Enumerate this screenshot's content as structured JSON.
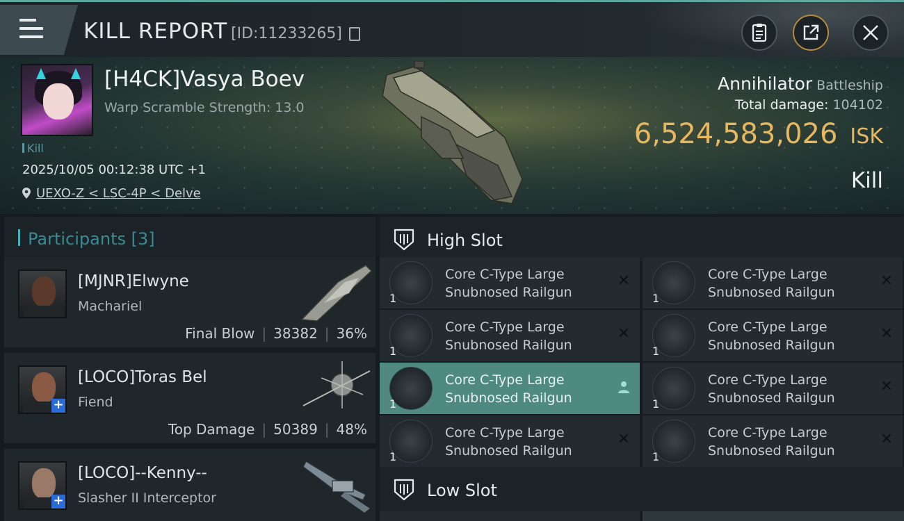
{
  "header": {
    "title": "KILL REPORT",
    "report_id": "[ID:11233265]"
  },
  "victim": {
    "name": "[H4CK]Vasya Boev",
    "warp_scramble": "Warp Scramble Strength: 13.0",
    "tag": "Kill",
    "timestamp": "2025/10/05 00:12:38 UTC +1",
    "location": "UEXO-Z < LSC-4P < Delve",
    "ship_name": "Annihilator",
    "ship_class": "Battleship",
    "total_damage_label": "Total damage:",
    "total_damage_value": "104102",
    "isk_value": "6,524,583,026",
    "isk_unit": "ISK",
    "result": "Kill"
  },
  "participants": {
    "label": "Participants",
    "count": "[3]",
    "rows": [
      {
        "name": "[MJNR]Elwyne",
        "ship": "Machariel",
        "role": "Final Blow",
        "damage": "38382",
        "percent": "36%"
      },
      {
        "name": "[LOCO]Toras Bel",
        "ship": "Fiend",
        "role": "Top Damage",
        "damage": "50389",
        "percent": "48%"
      },
      {
        "name": "[LOCO]--Kenny--",
        "ship": "Slasher II Interceptor",
        "role": "",
        "damage": "",
        "percent": ""
      }
    ]
  },
  "fitting": {
    "high_slot_label": "High Slot",
    "low_slot_label": "Low Slot",
    "high_slot_modules": [
      {
        "name_line1": "Core C-Type Large",
        "name_line2": "Snubnosed Railgun",
        "qty": "1",
        "status": "destroyed"
      },
      {
        "name_line1": "Core C-Type Large",
        "name_line2": "Snubnosed Railgun",
        "qty": "1",
        "status": "destroyed"
      },
      {
        "name_line1": "Core C-Type Large",
        "name_line2": "Snubnosed Railgun",
        "qty": "1",
        "status": "destroyed"
      },
      {
        "name_line1": "Core C-Type Large",
        "name_line2": "Snubnosed Railgun",
        "qty": "1",
        "status": "destroyed"
      },
      {
        "name_line1": "Core C-Type Large",
        "name_line2": "Snubnosed Railgun",
        "qty": "1",
        "status": "dropped"
      },
      {
        "name_line1": "Core C-Type Large",
        "name_line2": "Snubnosed Railgun",
        "qty": "1",
        "status": "destroyed"
      },
      {
        "name_line1": "Core C-Type Large",
        "name_line2": "Snubnosed Railgun",
        "qty": "1",
        "status": "destroyed"
      },
      {
        "name_line1": "Core C-Type Large",
        "name_line2": "Snubnosed Railgun",
        "qty": "1",
        "status": "destroyed"
      }
    ]
  },
  "colors": {
    "accent_teal": "#4bb0b8",
    "isk_gold": "#e8b860",
    "active_module": "#4f8a82",
    "share_ring": "#b58b3e"
  },
  "icons": {
    "menu": "hamburger-icon",
    "copy": "copy-icon",
    "clipboard": "clipboard-icon",
    "share": "share-icon",
    "close": "close-icon",
    "location": "location-pin-icon",
    "slot": "shield-slot-icon",
    "destroyed": "x-icon",
    "dropped": "person-icon"
  }
}
